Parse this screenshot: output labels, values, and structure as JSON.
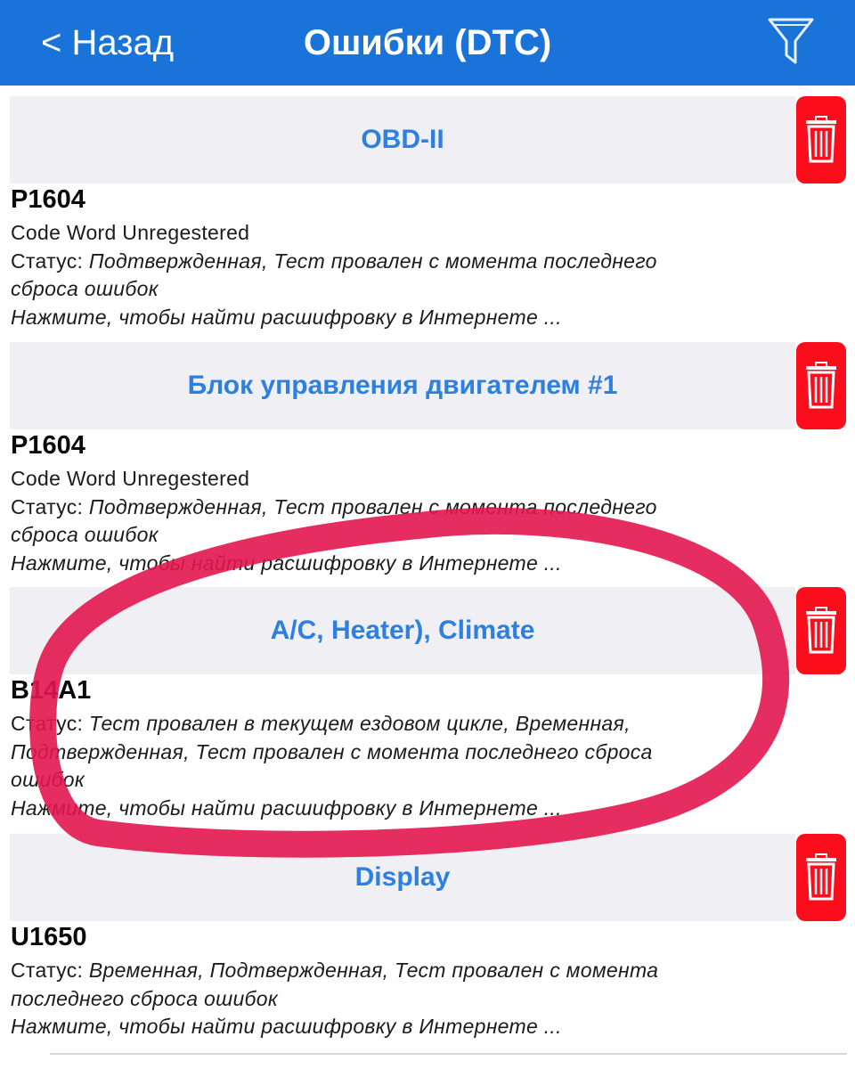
{
  "nav": {
    "back_label": "< Назад",
    "title": "Ошибки (DTC)",
    "filter_icon": "filter-funnel-icon"
  },
  "colors": {
    "nav_bg": "#1a73d9",
    "header_bg": "#efeff4",
    "header_text": "#2d7fe0",
    "delete_bg": "#fc0d1b"
  },
  "sections": [
    {
      "header": "OBD-II",
      "code": "P1604",
      "description": "Code Word Unregestered",
      "status_label": "Статус: ",
      "status_lines": [
        "Подтвержденная, Тест провален с момента последнего",
        "сброса ошибок"
      ],
      "hint": "Нажмите, чтобы найти расшифровку в Интернете ..."
    },
    {
      "header": "Блок управления двигателем #1",
      "code": "P1604",
      "description": "Code Word Unregestered",
      "status_label": "Статус: ",
      "status_lines": [
        "Подтвержденная, Тест провален с момента последнего",
        "сброса ошибок"
      ],
      "hint": "Нажмите, чтобы найти расшифровку в Интернете ..."
    },
    {
      "header": "A/C, Heater), Climate",
      "code": "B14A1",
      "status_label": "Статус: ",
      "status_lines": [
        "Тест провален в текущем ездовом цикле, Временная,",
        "Подтвержденная, Тест провален с момента последнего сброса",
        "ошибок"
      ],
      "hint": "Нажмите, чтобы найти расшифровку в Интернете ..."
    },
    {
      "header": "Display",
      "code": "U1650",
      "status_label": "Статус: ",
      "status_lines": [
        "Временная, Подтвержденная, Тест провален с момента",
        "последнего сброса ошибок"
      ],
      "hint": "Нажмите, чтобы найти расшифровку в Интернете ..."
    }
  ]
}
